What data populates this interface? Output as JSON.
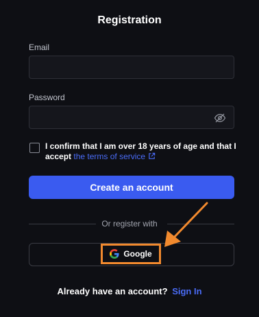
{
  "form": {
    "title": "Registration",
    "email": {
      "label": "Email",
      "value": "",
      "placeholder": ""
    },
    "password": {
      "label": "Password",
      "value": "",
      "placeholder": "",
      "visibility_icon": "eye-off-icon"
    },
    "confirm": {
      "checked": false,
      "text": "I confirm that I am over 18 years of age and that I accept",
      "terms_link": "the terms of service",
      "terms_icon": "external-link-icon"
    },
    "create_button": "Create an account",
    "divider_text": "Or register with",
    "google_button": {
      "label": "Google",
      "icon": "google-g-icon"
    },
    "footer": {
      "prompt": "Already have an account?",
      "signin_link": "Sign In"
    }
  },
  "annotation": {
    "arrow_icon": "arrow-down-left-icon",
    "color": "#f28a2e"
  },
  "colors": {
    "background": "#0e0f14",
    "accent": "#3a5bf0",
    "link": "#4a6cf7",
    "highlight": "#f28a2e"
  }
}
